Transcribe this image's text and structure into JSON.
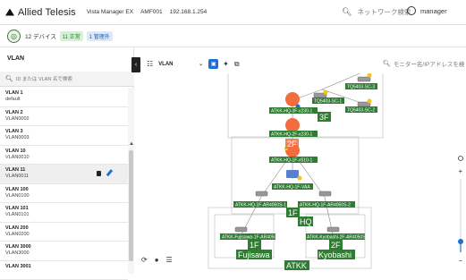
{
  "header": {
    "brand": "Allied Telesis",
    "breadcrumbs": [
      "Vista Manager EX",
      "AMF001",
      "192.168.1.254"
    ],
    "search_placeholder": "ネットワーク検索",
    "user": "manager"
  },
  "status": {
    "devices": "12 デバイス",
    "normal": "11 正常",
    "managed": "1 管理外"
  },
  "sidebar": {
    "title": "VLAN",
    "search_placeholder": "ID または VLAN 名で検索",
    "items": [
      {
        "name": "VLAN 1",
        "sub": "default"
      },
      {
        "name": "VLAN 2",
        "sub": "VLAN0002"
      },
      {
        "name": "VLAN 3",
        "sub": "VLAN0003"
      },
      {
        "name": "VLAN 10",
        "sub": "VLAN0010"
      },
      {
        "name": "VLAN 11",
        "sub": "VLAN0011"
      },
      {
        "name": "VLAN 100",
        "sub": "VLAN0100"
      },
      {
        "name": "VLAN 101",
        "sub": "VLAN0101"
      },
      {
        "name": "VLAN 200",
        "sub": "VLAN0200"
      },
      {
        "name": "VLAN 3000",
        "sub": "VLAN3000"
      },
      {
        "name": "VLAN 3001",
        "sub": ""
      }
    ]
  },
  "toolbar": {
    "vlan_select": "VLAN",
    "monitor_search_placeholder": "モニター名/IPアドレスを検"
  },
  "topology": {
    "nodes": [
      "TQ5403-SC-3",
      "TQ5403-SC-1",
      "TQ5403-SC-2",
      "ATKK-HQ-3F-x230-1",
      "ATKK-HQ-2F-x230-1",
      "ATKK-HQ-1F-x510-1",
      "ATKK-HQ-1F-VAA",
      "ATKK-HQ-1F-AR4050S-1",
      "ATKK-HQ-1F-AR4050S-2",
      "ATKK-Fujisawa-1F-AR4050S-1",
      "ATKK-Kyobashi-2F-AR4050S-1"
    ],
    "area_labels": [
      "3F",
      "2F",
      "1F",
      "HQ",
      "1F",
      "Fujisawa",
      "2F",
      "Kyobashi",
      "ATKK"
    ],
    "colors": {
      "label_green": "#2e7d32",
      "core_orange": "#f36c3d",
      "accent_blue": "#1f6fd6"
    }
  }
}
